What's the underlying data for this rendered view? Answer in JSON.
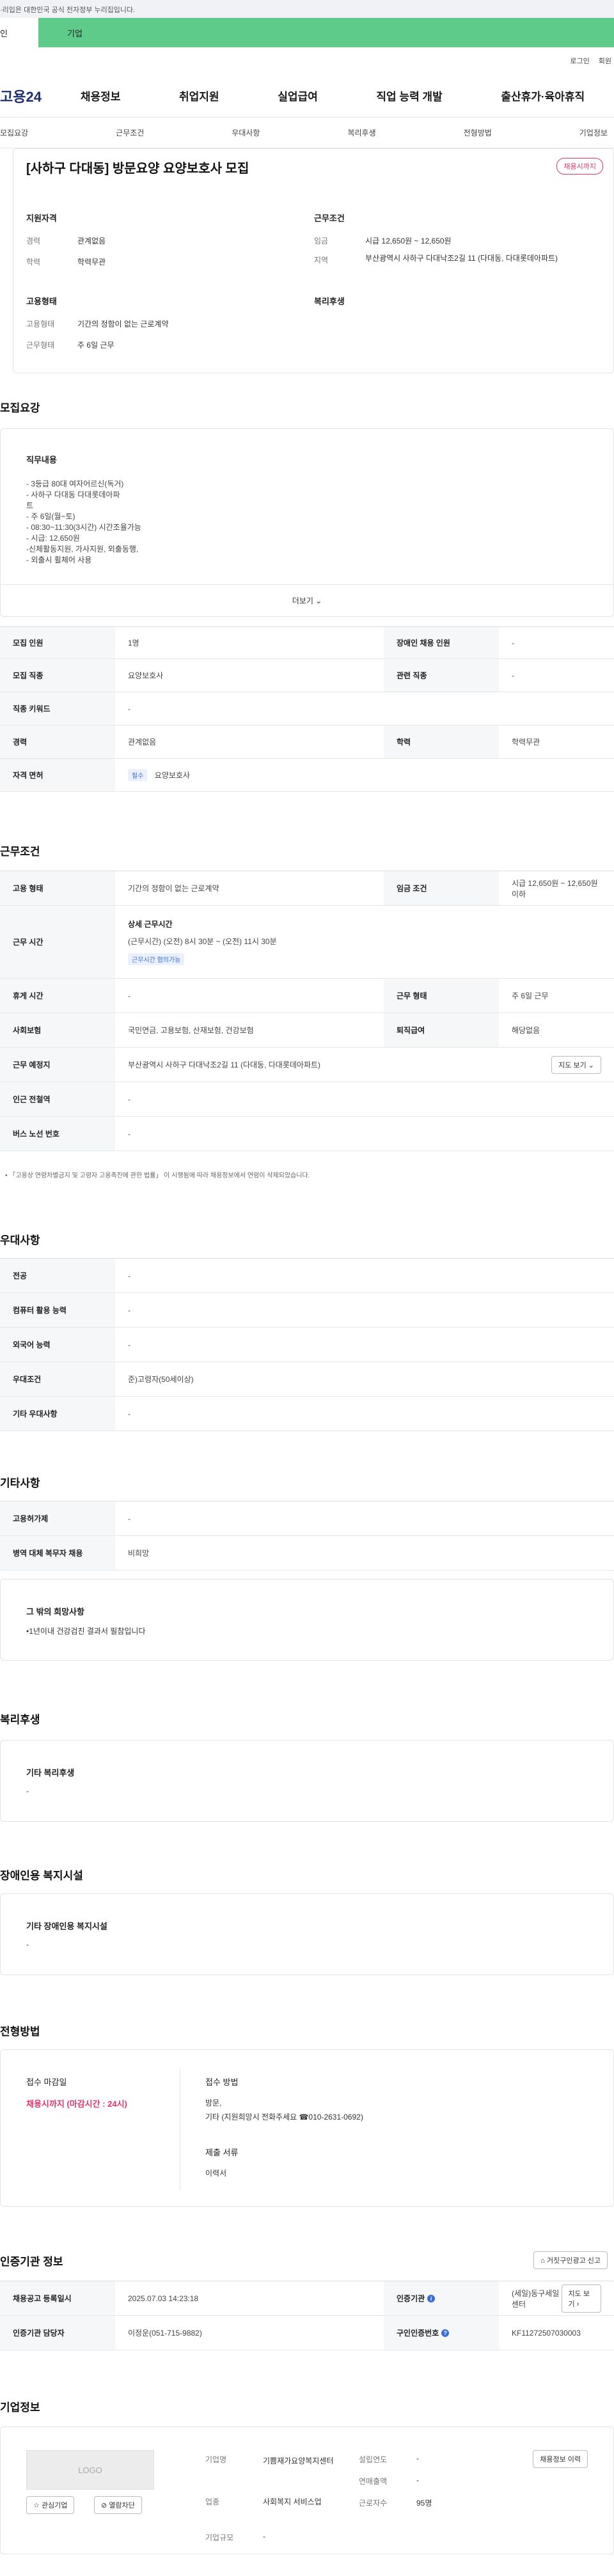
{
  "topbar": {
    "notice": "·리입은 대한민국 공식 전자정부 누리집입니다."
  },
  "tabs": {
    "person": "인",
    "corp": "기업"
  },
  "utils": {
    "login": "로그인",
    "join": "회원"
  },
  "gnb": {
    "logo": "고용24",
    "menu": [
      "채용정보",
      "취업지원",
      "실업급여",
      "직업 능력 개발",
      "출산휴가·육아휴직"
    ]
  },
  "subnav": [
    "모집요강",
    "근무조건",
    "우대사항",
    "복리후생",
    "전형방법",
    "기업정보"
  ],
  "job": {
    "title": "[사하구 다대동] 방문요양 요양보호사 모집",
    "status_chip": "채용시까지",
    "qualification_title": "지원자격",
    "career_label": "경력",
    "career_value": "관계없음",
    "edu_label": "학력",
    "edu_value": "학력무관",
    "employment_title": "고용형태",
    "emptype_label": "고용형태",
    "emptype_value": "기간의 정함이 없는 근로계약",
    "workdays_label": "근무형태",
    "workdays_value": "주 6일 근무",
    "condition_title": "근무조건",
    "wage_label": "임금",
    "wage_value": "시급 12,650원 ~ 12,650원",
    "region_label": "지역",
    "region_value": "부산광역시 사하구 다대낙조2길 11 (다대동, 다대롯데아파트)",
    "welfare_title": "복리후생"
  },
  "recruit": {
    "heading": "모집요강",
    "duty_title": "직무내용",
    "duty_lines": [
      "- 3등급 80대 여자어르신(독거)",
      "- 사하구 다대동 다대롯데아파",
      "트",
      "- 주 6일(월~토)",
      "- 08:30~11:30(3시간) 시간조율가능",
      "- 시급: 12,650원",
      "-신체활동지원, 가사지원, 외출동행,",
      "- 외출시 휠체어 사용"
    ],
    "more": "더보기",
    "rows": {
      "count_label": "모집 인원",
      "count_value": "1명",
      "disabled_label": "장애인 채용 인원",
      "disabled_value": "-",
      "job_label": "모집 직종",
      "job_value": "요양보호사",
      "related_label": "관련 직종",
      "related_value": "-",
      "keyword_label": "직종 키워드",
      "keyword_value": "-",
      "career_label": "경력",
      "career_value": "관계없음",
      "edu_label": "학력",
      "edu_value": "학력무관",
      "license_label": "자격 면허",
      "license_badge": "필수",
      "license_value": "요양보호사"
    }
  },
  "condition": {
    "heading": "근무조건",
    "emptype_label": "고용 형태",
    "emptype_value": "기간의 정함이 없는 근로계약",
    "wage_label": "임금 조건",
    "wage_value": "시급 12,650원 ~ 12,650원 이하",
    "hours_label": "근무 시간",
    "hours_title": "상세 근무시간",
    "hours_value": "(근무시간) (오전) 8시 30분 ~ (오전) 11시 30분",
    "hours_badge": "근무시간 협의가능",
    "break_label": "휴게 시간",
    "break_value": "-",
    "shape_label": "근무 형태",
    "shape_value": "주 6일 근무",
    "insurance_label": "사회보험",
    "insurance_value": "국민연금, 고용보험, 산재보험, 건강보험",
    "severance_label": "퇴직급여",
    "severance_value": "해당없음",
    "place_label": "근무 예정지",
    "place_value": "부산광역시 사하구 다대낙조2길 11 (다대동, 다대롯데아파트)",
    "map_button": "지도 보기",
    "subway_label": "인근 전철역",
    "subway_value": "-",
    "bus_label": "버스 노선 번호",
    "bus_value": "-",
    "note": "「고용상 연령차별금지 및 고령자 고용촉진에 관한 법률」 이 시행됨에 따라 채용정보에서 연령이 삭제되었습니다."
  },
  "prefer": {
    "heading": "우대사항",
    "major_label": "전공",
    "major_value": "-",
    "computer_label": "컴퓨터 활용 능력",
    "computer_value": "-",
    "language_label": "외국어 능력",
    "language_value": "-",
    "cond_label": "우대조건",
    "cond_value": "준)고령자(50세이상)",
    "etc_label": "기타 우대사항",
    "etc_value": "-"
  },
  "etc": {
    "heading": "기타사항",
    "support_label": "고용허가제",
    "support_value": "-",
    "military_label": "병역 대체 복무자 채용",
    "military_value": "비희망",
    "other_title": "그 밖의 희망사항",
    "other_value": "•1년이내 건강검진 결과서 필참입니다"
  },
  "welfare": {
    "heading": "복리후생",
    "title": "기타 복리후생",
    "value": "-"
  },
  "disabled": {
    "heading": "장애인용 복지시설",
    "title": "기타 장애인용 복지시설",
    "value": "-"
  },
  "process": {
    "heading": "전형방법",
    "deadline_title": "접수 마감일",
    "deadline_value": "채용시까지 (마감시간 : 24시)",
    "method_title": "접수 방법",
    "method_lines": [
      "방문,",
      "기타 (지원희망시 전화주세요 ☎010-2631-0692)"
    ],
    "docs_title": "제출 서류",
    "docs_value": "이력서"
  },
  "agency": {
    "heading": "인증기관 정보",
    "report_button": "거짓구인광고 신고",
    "regdate_label": "채용공고 등록일시",
    "regdate_value": "2025.07.03 14:23:18",
    "agency_label": "인증기관",
    "agency_value": "(세일)동구세일센터",
    "map_button": "지도 보기",
    "manager_label": "인증기관 담당자",
    "manager_value": "이정운(051-715-9882)",
    "certno_label": "구인인증번호",
    "certno_value": "KF11272507030003"
  },
  "company": {
    "heading": "기업정보",
    "logo_text": "LOGO",
    "interest_button": "관심기업",
    "block_button": "열람차단",
    "name_label": "기업명",
    "name_value": "기쁨재가요양복지센터",
    "founded_label": "설립연도",
    "founded_value": "-",
    "sales_label": "연매출액",
    "sales_value": "-",
    "industry_label": "업종",
    "industry_value": "사회복지 서비스업",
    "workers_label": "근로자수",
    "workers_value": "95명",
    "scale_label": "기업규모",
    "scale_value": "-",
    "info_button": "채용정보 이력"
  }
}
